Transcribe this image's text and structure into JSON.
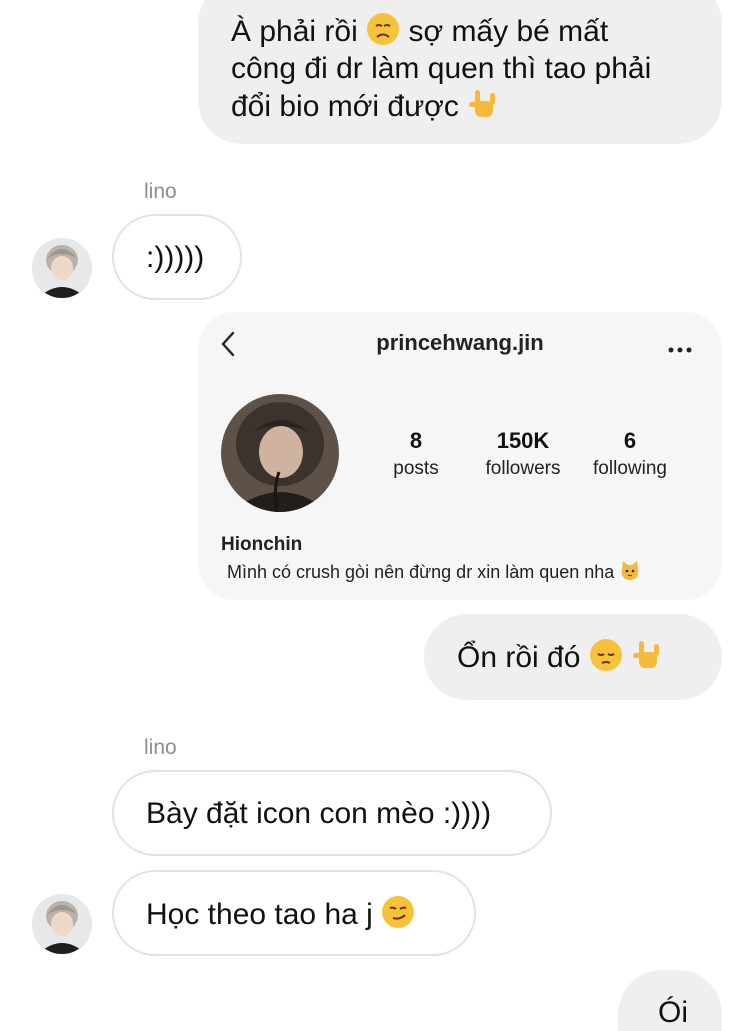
{
  "messages": {
    "m1": {
      "line1": "À phải rồi",
      "line1b": "sợ mấy bé mất",
      "line2": "công đi dr làm quen thì tao phải",
      "line3": "đổi bio mới được"
    },
    "sender1": "lino",
    "m2": ":)))))",
    "m3": "Ổn rồi đó",
    "sender2": "lino",
    "m4": "Bày đặt icon con mèo :))))",
    "m5": "Học theo tao ha j",
    "m6": "Ói"
  },
  "profile_card": {
    "username": "princehwang.jin",
    "stats": [
      {
        "value": "8",
        "label": "posts"
      },
      {
        "value": "150K",
        "label": "followers"
      },
      {
        "value": "6",
        "label": "following"
      }
    ],
    "name": "Hionchin",
    "bio": "Mình có crush gòi nên đừng dr xin làm quen nha"
  },
  "icons": [
    "disappointed-face-emoji",
    "love-you-gesture-emoji",
    "pensive-face-emoji",
    "cat-face-emoji",
    "smirking-face-emoji",
    "back-chevron-icon",
    "more-options-icon"
  ],
  "colors": {
    "outgoing_bubble": "#efefef",
    "incoming_border": "#e3e3e3",
    "card_bg": "#f6f6f6",
    "sender_name": "#8e8e8e"
  }
}
